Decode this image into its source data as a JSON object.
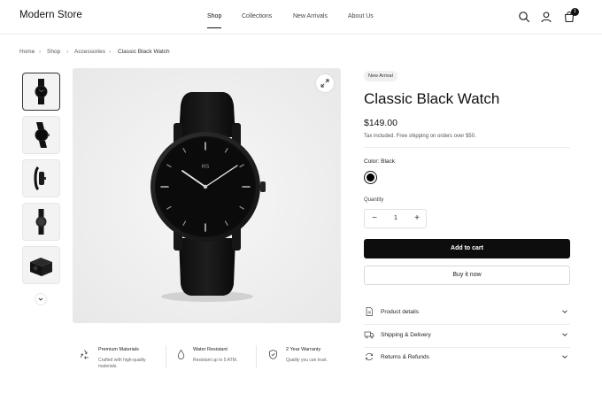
{
  "header": {
    "brand": "Modern Store",
    "nav": [
      "Shop",
      "Collections",
      "New Arrivals",
      "About Us"
    ],
    "active_nav": "Shop",
    "cart_count": "1",
    "icons": [
      "search-icon",
      "user-icon",
      "cart-icon"
    ]
  },
  "breadcrumb": [
    "Home",
    "Shop",
    "Accessories",
    "Classic Black Watch"
  ],
  "gallery": {
    "thumbnails": [
      "front",
      "angled",
      "side",
      "back",
      "packaging"
    ],
    "watch_dial_text": "MS"
  },
  "features": [
    {
      "title": "Premium Materials",
      "desc_lines": [
        "Crafted with high-quality",
        "materials."
      ],
      "icon": "recycle-icon"
    },
    {
      "title": "Water Resistant",
      "desc_lines": [
        "Resistant up to 5 ATM."
      ],
      "icon": "water-drop-icon"
    },
    {
      "title": "2 Year Warranty",
      "desc_lines": [
        "Quality you can trust."
      ],
      "icon": "shield-check-icon"
    }
  ],
  "product": {
    "badge": "New Arrival",
    "title": "Classic Black Watch",
    "price": "$149.00",
    "tax_note": "Tax included. Free shipping on orders over $50.",
    "color_label": "Color: Black",
    "selected_color": "#000000",
    "quantity_label": "Quantity",
    "quantity": "1",
    "add_to_cart": "Add to cart",
    "buy_now": "Buy it now"
  },
  "accordions": [
    {
      "label": "Product details",
      "icon": "document-icon"
    },
    {
      "label": "Shipping & Delivery",
      "icon": "truck-icon"
    },
    {
      "label": "Returns & Refunds",
      "icon": "refresh-icon"
    }
  ],
  "colors": {
    "accent": "#0d0d0d",
    "border": "#e6e6e6",
    "image_bg": "#efefef"
  }
}
